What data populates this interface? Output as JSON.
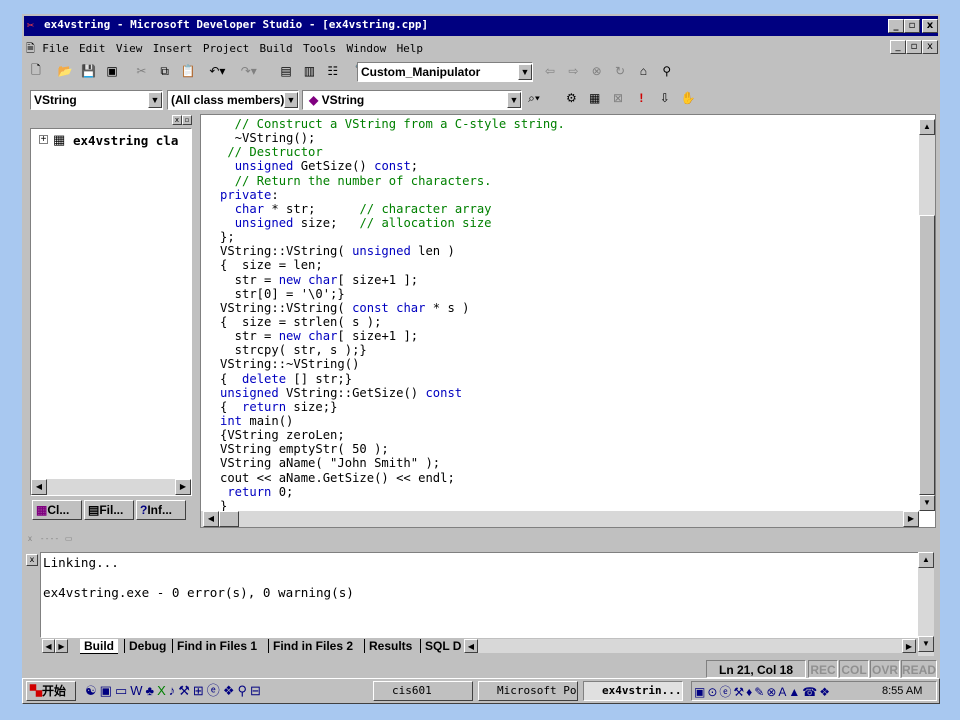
{
  "window": {
    "title": "ex4vstring - Microsoft Developer Studio - [ex4vstring.cpp]",
    "minimize": "_",
    "maximize": "▫",
    "close": "x"
  },
  "menu": [
    "File",
    "Edit",
    "View",
    "Insert",
    "Project",
    "Build",
    "Tools",
    "Window",
    "Help"
  ],
  "toolbar": {
    "find_combo": "Custom_Manipulator",
    "class_combo": "VString",
    "filter_combo": "(All class members)",
    "member_combo": "VString"
  },
  "workspace": {
    "tree_root": "ex4vstring cla",
    "tabs": [
      "Cl...",
      "Fil...",
      "Inf..."
    ]
  },
  "code": [
    [
      [
        "cm",
        "  // Construct a VString from a C-style string."
      ]
    ],
    [
      [
        "t",
        "  ~VString();"
      ]
    ],
    [
      [
        "t",
        " "
      ],
      [
        "cm",
        "// Destructor"
      ]
    ],
    [
      [
        "t",
        "  "
      ],
      [
        "kw",
        "unsigned"
      ],
      [
        "t",
        " GetSize() "
      ],
      [
        "kw",
        "const"
      ],
      [
        "t",
        ";"
      ]
    ],
    [
      [
        "t",
        "  "
      ],
      [
        "cm",
        "// Return the number of characters."
      ]
    ],
    [
      [
        "kw",
        "private"
      ],
      [
        "t",
        ":"
      ]
    ],
    [
      [
        "t",
        "  "
      ],
      [
        "kw",
        "char"
      ],
      [
        "t",
        " * str;      "
      ],
      [
        "cm",
        "// character array"
      ]
    ],
    [
      [
        "t",
        "  "
      ],
      [
        "kw",
        "unsigned"
      ],
      [
        "t",
        " size;   "
      ],
      [
        "cm",
        "// allocation size"
      ]
    ],
    [
      [
        "t",
        "};"
      ]
    ],
    [
      [
        "t",
        "VString::VString( "
      ],
      [
        "kw",
        "unsigned"
      ],
      [
        "t",
        " len )"
      ]
    ],
    [
      [
        "t",
        "{  size = len;"
      ]
    ],
    [
      [
        "t",
        "  str = "
      ],
      [
        "kw",
        "new"
      ],
      [
        "t",
        " "
      ],
      [
        "kw",
        "char"
      ],
      [
        "t",
        "[ size+1 ];"
      ]
    ],
    [
      [
        "t",
        "  str[0] = '\\0';}"
      ]
    ],
    [
      [
        "t",
        "VString::VString( "
      ],
      [
        "kw",
        "const"
      ],
      [
        "t",
        " "
      ],
      [
        "kw",
        "char"
      ],
      [
        "t",
        " * s )"
      ]
    ],
    [
      [
        "t",
        "{  size = strlen( s );"
      ]
    ],
    [
      [
        "t",
        "  str = "
      ],
      [
        "kw",
        "new"
      ],
      [
        "t",
        " "
      ],
      [
        "kw",
        "char"
      ],
      [
        "t",
        "[ size+1 ];"
      ]
    ],
    [
      [
        "t",
        "  strcpy( str, s );}"
      ]
    ],
    [
      [
        "t",
        "VString::~VString()"
      ]
    ],
    [
      [
        "t",
        "{  "
      ],
      [
        "kw",
        "delete"
      ],
      [
        "t",
        " [] str;}"
      ]
    ],
    [
      [
        "kw",
        "unsigned"
      ],
      [
        "t",
        " VString::GetSize() "
      ],
      [
        "kw",
        "const"
      ]
    ],
    [
      [
        "t",
        "{  "
      ],
      [
        "kw",
        "return"
      ],
      [
        "t",
        " size;}"
      ]
    ],
    [
      [
        "kw",
        "int"
      ],
      [
        "t",
        " main()"
      ]
    ],
    [
      [
        "t",
        "{VString zeroLen;"
      ]
    ],
    [
      [
        "t",
        "VString emptyStr( 50 );"
      ]
    ],
    [
      [
        "t",
        "VString aName( \"John Smith\" );"
      ]
    ],
    [
      [
        "t",
        "cout << aName.GetSize() << endl;"
      ]
    ],
    [
      [
        "t",
        " "
      ],
      [
        "kw",
        "return"
      ],
      [
        "t",
        " 0;"
      ]
    ],
    [
      [
        "t",
        "}"
      ]
    ]
  ],
  "output": {
    "lines": [
      "Linking...",
      "",
      "ex4vstring.exe - 0 error(s), 0 warning(s)"
    ],
    "tabs": [
      "Build",
      "Debug",
      "Find in Files 1",
      "Find in Files 2",
      "Results",
      "SQL D"
    ]
  },
  "status": {
    "position": "Ln 21, Col 18",
    "indicators": [
      "REC",
      "COL",
      "OVR",
      "READ"
    ]
  },
  "taskbar": {
    "start": "开始",
    "buttons": [
      "cis601",
      "Microsoft Po...",
      "ex4vstrin..."
    ],
    "clock": "8:55 AM"
  },
  "colors": {
    "titlebar": "#000080",
    "keyword": "#0000c0",
    "comment": "#008000",
    "desktop": "#a8c8f0"
  }
}
